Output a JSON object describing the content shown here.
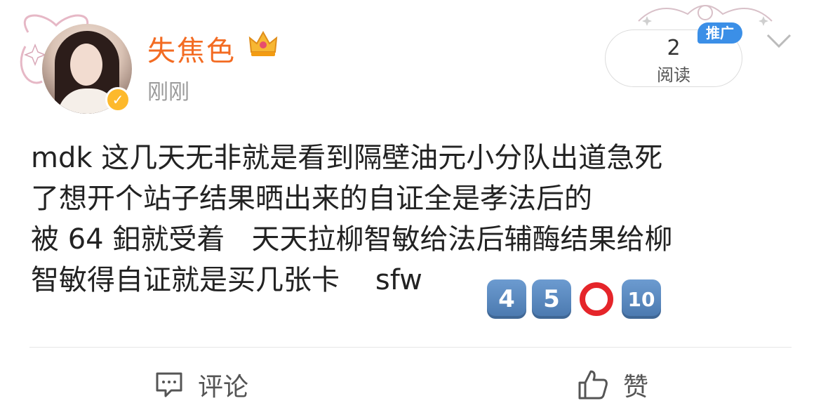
{
  "post": {
    "username": "失焦色",
    "time": "刚刚",
    "text_line1": "mdk 这几天无非就是看到隔壁油元小分队出道急死",
    "text_line2": "了想开个站子结果晒出来的自证全是孝法后的",
    "text_line3": "被 64 鈤就受着   天天拉柳智敏给法后辅酶结果给柳",
    "text_line4": "智敏得自证就是买几张卡    sfw",
    "emojis": [
      "4",
      "5",
      "⭕",
      "10"
    ]
  },
  "reads": {
    "count": "2",
    "label": "阅读",
    "badge": "推广"
  },
  "actions": {
    "comment_label": "评论",
    "like_label": "赞"
  },
  "colors": {
    "username": "#f36b22",
    "promo": "#3b8fe7",
    "verified": "#fdb92c"
  },
  "icons": [
    "verified-icon",
    "crown-icon",
    "chevron-down-icon",
    "comment-icon",
    "like-icon"
  ]
}
